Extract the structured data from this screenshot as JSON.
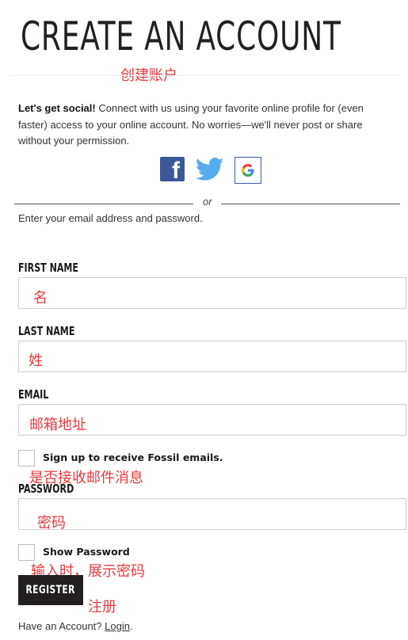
{
  "header": {
    "title": "CREATE AN ACCOUNT",
    "title_note": "创建账户"
  },
  "intro": {
    "bold": "Let's get social!",
    "text": " Connect with us using your favorite online profile for (even faster) access to your online account. No worries—we'll never post or share without your permission."
  },
  "social": {
    "facebook_icon": "facebook-icon",
    "twitter_icon": "twitter-icon",
    "google_icon": "google-icon"
  },
  "divider": {
    "or_text": "or"
  },
  "helper_text": "Enter your email address and password.",
  "form": {
    "first_name": {
      "label": "FIRST NAME",
      "note": "名",
      "value": ""
    },
    "last_name": {
      "label": "LAST NAME",
      "note": "姓",
      "value": ""
    },
    "email": {
      "label": "EMAIL",
      "note": "邮箱地址",
      "value": ""
    },
    "signup": {
      "label": "Sign up to receive Fossil emails.",
      "note": "是否接收邮件消息",
      "checked": false
    },
    "password": {
      "label": "PASSWORD",
      "note": "密码",
      "value": ""
    },
    "show_password": {
      "label": "Show Password",
      "note": "输入时，展示密码",
      "checked": false
    },
    "register": {
      "label": "REGISTER",
      "note": "注册"
    }
  },
  "footer": {
    "text": "Have an Account?",
    "login_link": "Login",
    "suffix": "."
  },
  "colors": {
    "annotation": "#e8393e",
    "button_bg": "#231f20",
    "facebook": "#3b5998",
    "twitter": "#55acee"
  }
}
